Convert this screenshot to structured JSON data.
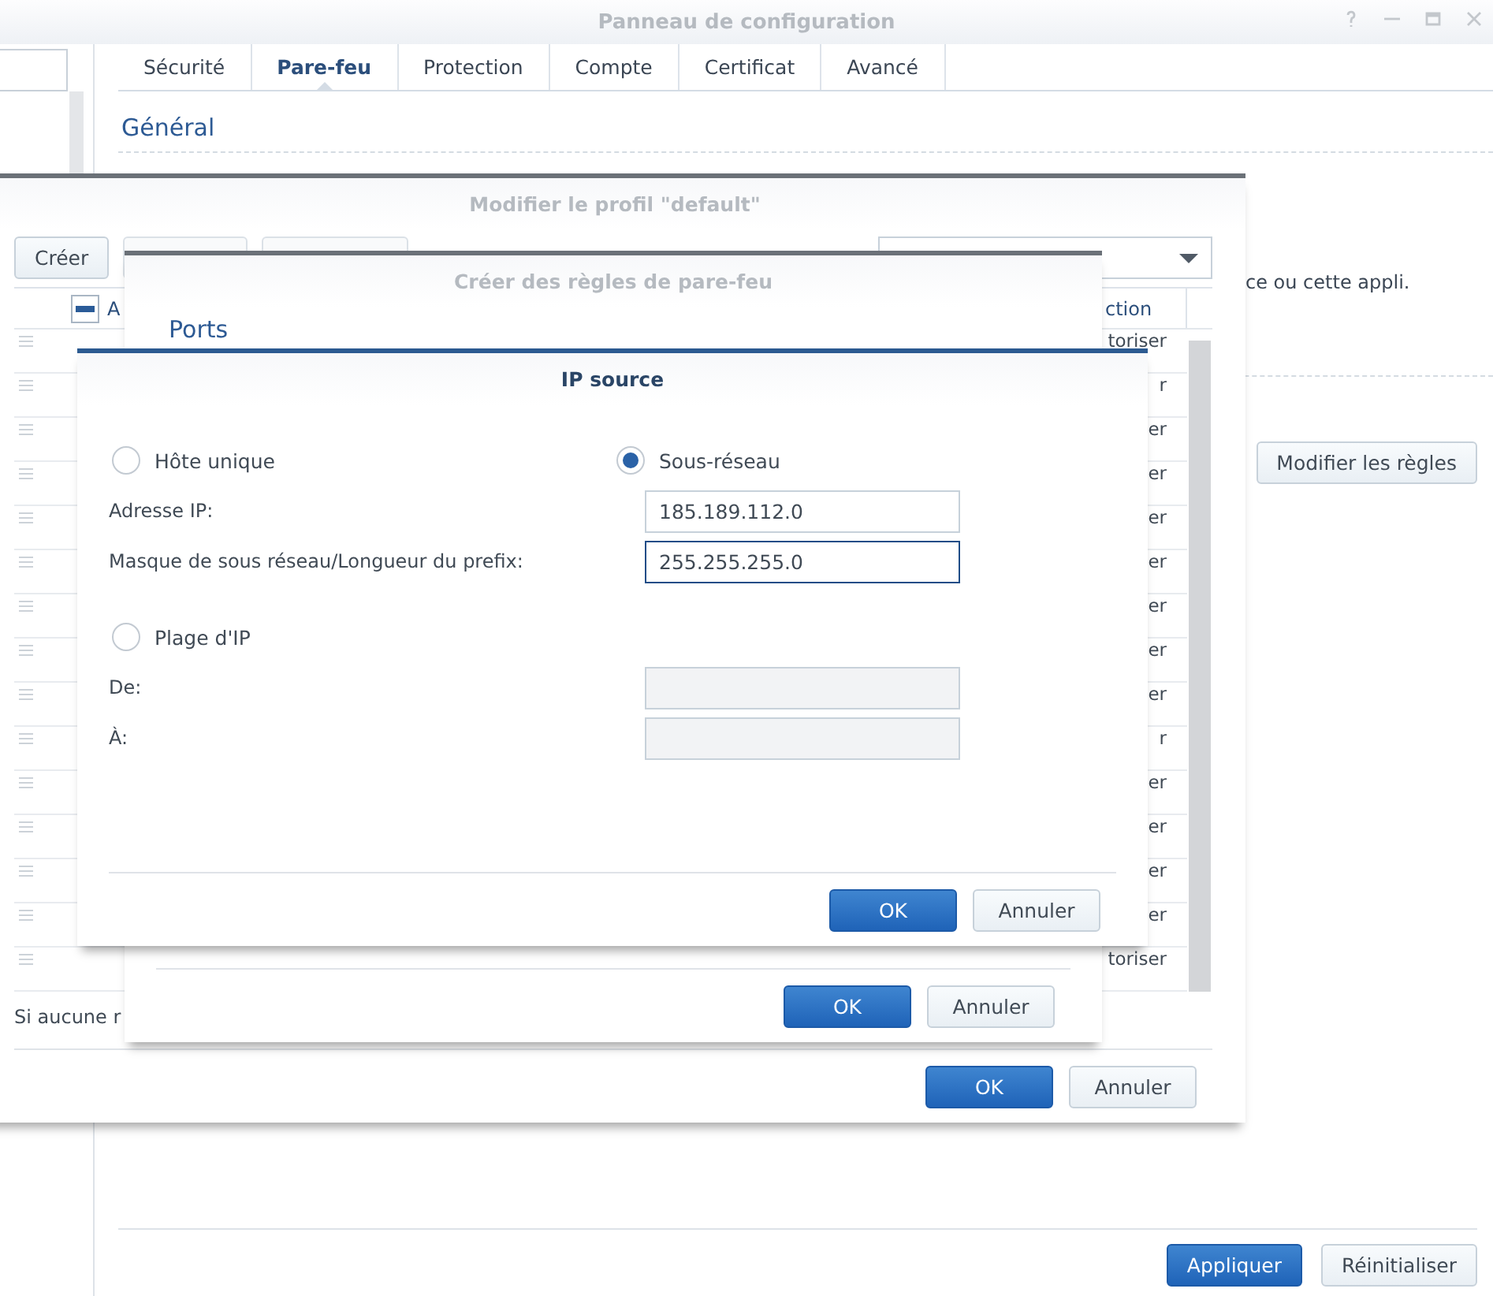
{
  "window": {
    "title": "Panneau de configuration"
  },
  "tabs": [
    {
      "label": "Sécurité",
      "selected": false
    },
    {
      "label": "Pare-feu",
      "selected": true
    },
    {
      "label": "Protection",
      "selected": false
    },
    {
      "label": "Compte",
      "selected": false
    },
    {
      "label": "Certificat",
      "selected": false
    },
    {
      "label": "Avancé",
      "selected": false
    }
  ],
  "section_title": "Général",
  "description_fragment": "ce ou cette appli.",
  "edit_rules_button": "Modifier les règles",
  "footer_buttons": [
    {
      "label": "Appliquer",
      "kind": "primary"
    },
    {
      "label": "Réinitialiser",
      "kind": "secondary"
    }
  ],
  "profile_dialog": {
    "title": "Modifier le profil \"default\"",
    "toolbar": [
      {
        "label": "Créer",
        "disabled": false
      },
      {
        "disabled": true
      },
      {
        "disabled": true
      }
    ],
    "select_all_mixed": true,
    "columns": [
      "A",
      "ction"
    ],
    "rows": [
      {
        "action": "toriser"
      },
      {
        "action": "r"
      },
      {
        "action": "er"
      },
      {
        "action": "er"
      },
      {
        "action": "er"
      },
      {
        "action": "er"
      },
      {
        "action": "er"
      },
      {
        "action": "er"
      },
      {
        "action": "er"
      },
      {
        "action": "r"
      },
      {
        "action": "er"
      },
      {
        "action": "er"
      },
      {
        "action": "er"
      },
      {
        "action": "er"
      },
      {
        "action": "toriser"
      }
    ],
    "note": "Si aucune r",
    "buttons": [
      {
        "label": "OK",
        "kind": "primary"
      },
      {
        "label": "Annuler",
        "kind": "secondary"
      }
    ]
  },
  "rules_dialog": {
    "title": "Créer des règles de pare-feu",
    "section": "Ports",
    "buttons": [
      {
        "label": "OK",
        "kind": "primary"
      },
      {
        "label": "Annuler",
        "kind": "secondary"
      }
    ]
  },
  "ip_dialog": {
    "title": "IP source",
    "modes": [
      {
        "label": "Hôte unique",
        "selected": false
      },
      {
        "label": "Sous-réseau",
        "selected": true
      }
    ],
    "subnet_fields": [
      {
        "label": "Adresse IP:",
        "value": "185.189.112.0",
        "focused": false
      },
      {
        "label": "Masque de sous réseau/Longueur du prefix:",
        "value": "255.255.255.0",
        "focused": true
      }
    ],
    "range_option": {
      "label": "Plage d'IP",
      "selected": false
    },
    "range_fields": [
      {
        "label": "De:",
        "disabled": true
      },
      {
        "label": "À:",
        "disabled": true
      }
    ],
    "buttons": [
      {
        "label": "OK",
        "kind": "primary"
      },
      {
        "label": "Annuler",
        "kind": "secondary"
      }
    ]
  }
}
